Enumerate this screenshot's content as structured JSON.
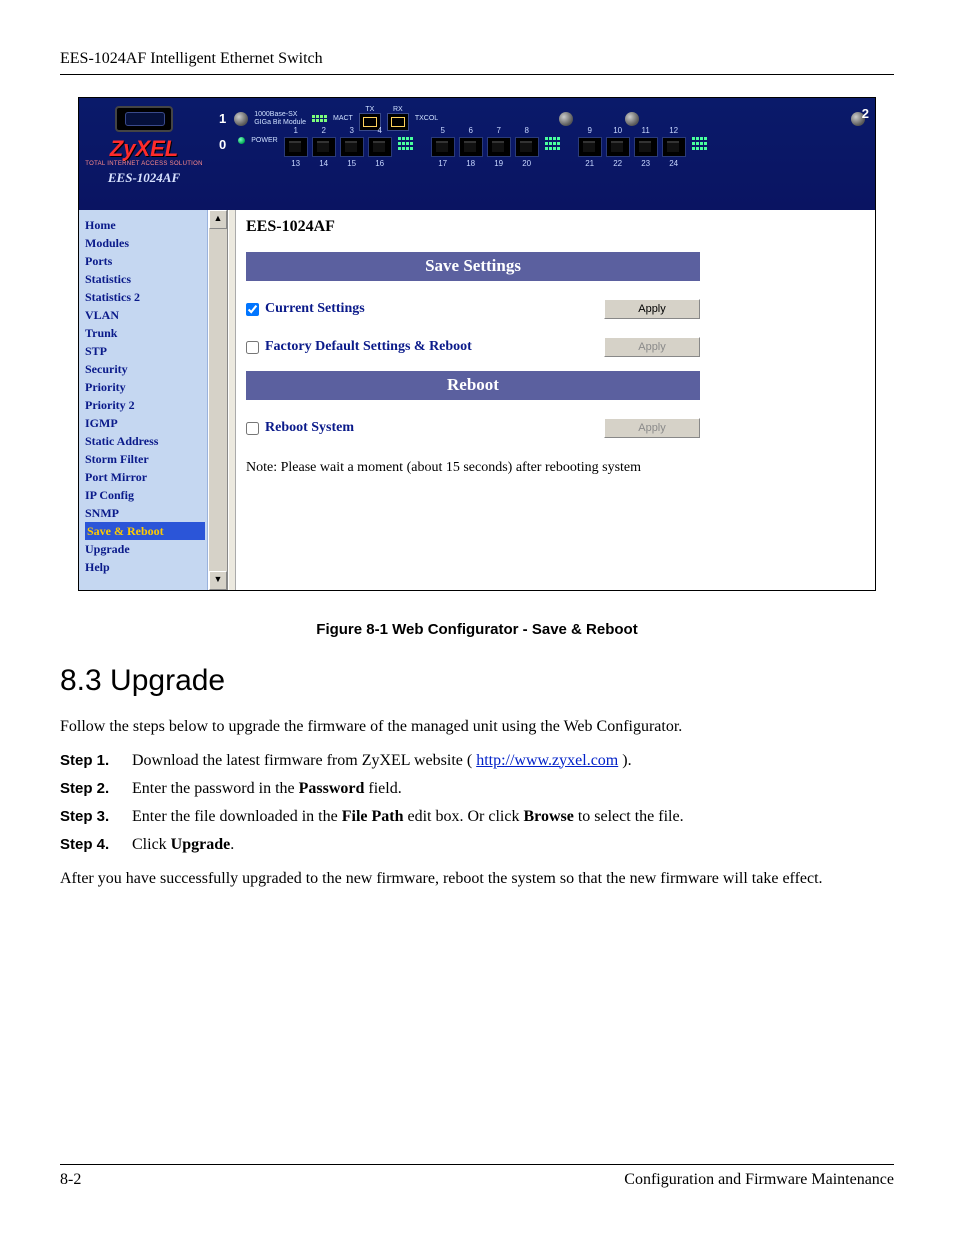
{
  "doc": {
    "header": "EES-1024AF Intelligent Ethernet Switch",
    "page_num": "8-2",
    "footer_title": "Configuration and Firmware Maintenance"
  },
  "banner": {
    "brand": "ZyXEL",
    "brand_sub": "TOTAL INTERNET ACCESS SOLUTION",
    "model": "EES-1024AF",
    "slot1": "1",
    "slot2": "2",
    "slot0": "0",
    "slot_label1": "1000Base-SX",
    "slot_label2": "GIGa Bit Module",
    "mact": "MACT",
    "tx": "TX",
    "rx": "RX",
    "txcol": "TXCOL",
    "power": "POWER"
  },
  "ports": {
    "top": [
      "1",
      "2",
      "3",
      "4",
      "5",
      "6",
      "7",
      "8",
      "9",
      "10",
      "11",
      "12"
    ],
    "bot": [
      "13",
      "14",
      "15",
      "16",
      "17",
      "18",
      "19",
      "20",
      "21",
      "22",
      "23",
      "24"
    ]
  },
  "nav": {
    "items": [
      "Home",
      "Modules",
      "Ports",
      "Statistics",
      "Statistics 2",
      "VLAN",
      "Trunk",
      "STP",
      "Security",
      "Priority",
      "Priority 2",
      "IGMP",
      "Static Address",
      "Storm Filter",
      "Port Mirror",
      "IP Config",
      "SNMP",
      "Save & Reboot",
      "Upgrade",
      "Help"
    ],
    "selected_index": 17
  },
  "content": {
    "model": "EES-1024AF",
    "bar_save": "Save Settings",
    "row_current": "Current Settings",
    "row_factory": "Factory Default Settings & Reboot",
    "bar_reboot": "Reboot",
    "row_reboot": "Reboot System",
    "apply": "Apply",
    "note": "Note: Please wait a moment (about 15 seconds) after rebooting system"
  },
  "figure_caption": "Figure 8-1 Web Configurator - Save & Reboot",
  "section_heading": "8.3 Upgrade",
  "intro": "Follow the steps below to upgrade the firmware of the managed unit using the Web Configurator.",
  "steps": {
    "s1_label": "Step 1.",
    "s1_a": "Download the latest firmware from ZyXEL website ( ",
    "s1_link": "http://www.zyxel.com",
    "s1_b": " ).",
    "s2_label": "Step 2.",
    "s2_a": "Enter the password in the ",
    "s2_bold": "Password",
    "s2_b": " field.",
    "s3_label": "Step 3.",
    "s3_a": "Enter the file downloaded in the ",
    "s3_bold1": "File Path",
    "s3_b": " edit box. Or click ",
    "s3_bold2": "Browse",
    "s3_c": "  to select the file.",
    "s4_label": "Step 4.",
    "s4_a": "Click ",
    "s4_bold": "Upgrade",
    "s4_b": "."
  },
  "outro": "After you have successfully upgraded to the new firmware, reboot the system so that the new firmware will take effect."
}
